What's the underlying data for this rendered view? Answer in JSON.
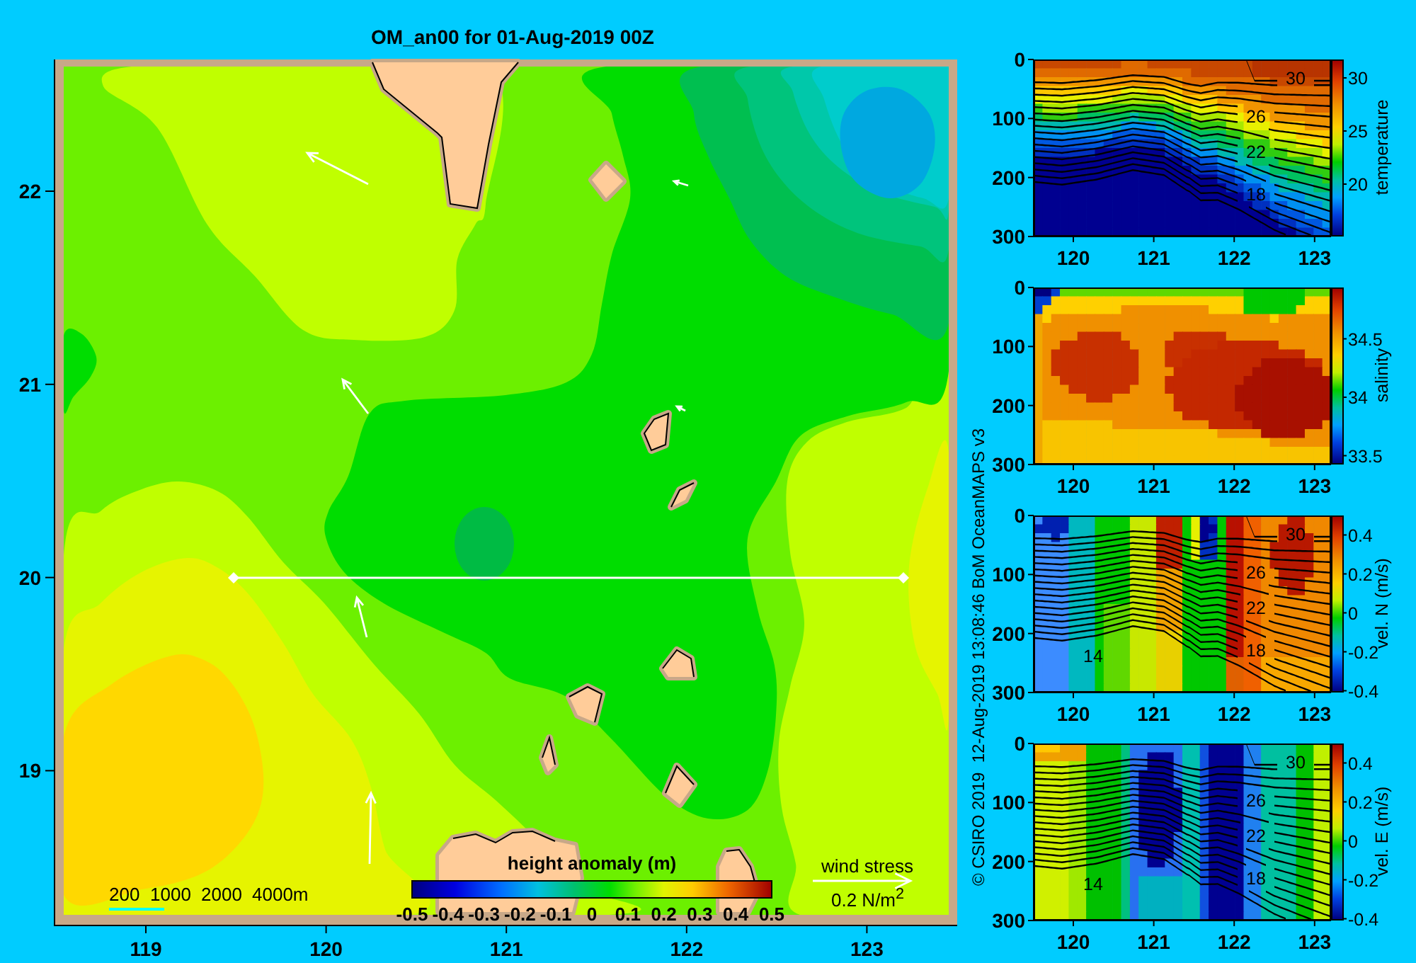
{
  "map": {
    "title": "OM_an00 for 01-Aug-2019 00Z",
    "x_ticks": [
      "119",
      "120",
      "121",
      "122",
      "123"
    ],
    "y_ticks": [
      "22",
      "21",
      "20",
      "19"
    ],
    "depth_legend": [
      "200",
      "1000",
      "2000",
      "4000m"
    ],
    "colorbar": {
      "title": "height anomaly (m)",
      "ticks": [
        "-0.5",
        "-0.4",
        "-0.3",
        "-0.2",
        "-0.1",
        "0",
        "0.1",
        "0.2",
        "0.3",
        "0.4",
        "0.5"
      ]
    },
    "wind_legend": {
      "label": "wind stress",
      "scale": "0.2 N/m$^{2}$"
    }
  },
  "sections": [
    {
      "kind": "temperature",
      "y_ticks": [
        "0",
        "100",
        "200",
        "300"
      ],
      "x_ticks": [
        "120",
        "121",
        "122",
        "123"
      ],
      "colorbar_ticks": [
        "30",
        "25",
        "20"
      ],
      "colorbar_title": "temperature",
      "contour_labels": [
        "30",
        "26",
        "22",
        "18"
      ]
    },
    {
      "kind": "salinity",
      "y_ticks": [
        "0",
        "100",
        "200",
        "300"
      ],
      "x_ticks": [
        "120",
        "121",
        "122",
        "123"
      ],
      "colorbar_ticks": [
        "34.5",
        "34",
        "33.5"
      ],
      "colorbar_title": "salinity"
    },
    {
      "kind": "northward",
      "y_ticks": [
        "0",
        "100",
        "200",
        "300"
      ],
      "x_ticks": [
        "120",
        "121",
        "122",
        "123"
      ],
      "colorbar_ticks": [
        "0.4",
        "0.2",
        "0",
        "-0.2",
        "-0.4"
      ],
      "colorbar_title": "vel. N (m/s)",
      "contour_labels": [
        "30",
        "26",
        "22",
        "18",
        "14"
      ]
    },
    {
      "kind": "eastward",
      "y_ticks": [
        "0",
        "100",
        "200",
        "300"
      ],
      "x_ticks": [
        "120",
        "121",
        "122",
        "123"
      ],
      "colorbar_ticks": [
        "0.4",
        "0.2",
        "0",
        "-0.2",
        "-0.4"
      ],
      "colorbar_title": "vel. E (m/s)",
      "contour_labels": [
        "30",
        "26",
        "22",
        "18",
        "14"
      ]
    }
  ],
  "credit": "© CSIRO 2019  12-Aug-2019 13:08:46 BoM OceanMAPS v3"
}
